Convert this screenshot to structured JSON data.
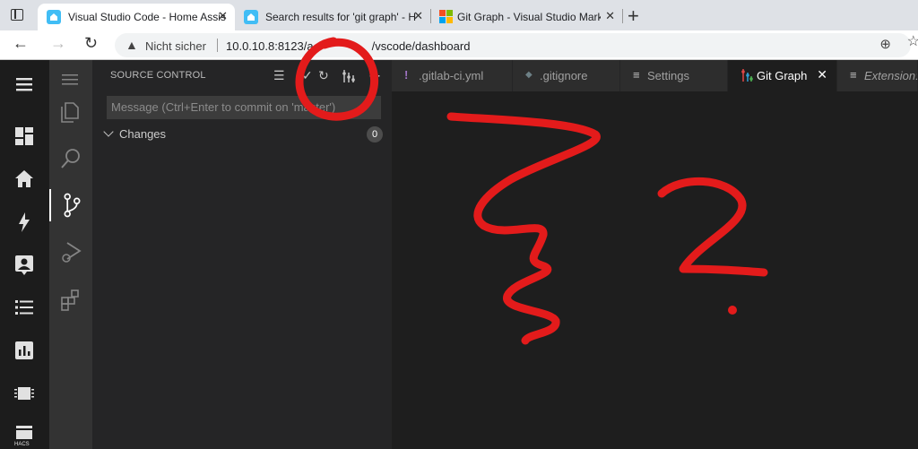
{
  "browser": {
    "tabs": [
      {
        "title": "Visual Studio Code - Home Assis",
        "icon": "home-assistant-icon",
        "active": true
      },
      {
        "title": "Search results for 'git graph' - H",
        "icon": "home-assistant-icon",
        "active": false
      },
      {
        "title": "Git Graph - Visual Studio Market",
        "icon": "microsoft-icon",
        "active": false
      }
    ],
    "close_glyph": "✕",
    "new_tab_glyph": "+",
    "security_label": "Nicht sicher",
    "url": "10.0.10.8:8123/a                  /vscode/dashboard"
  },
  "ha_sidebar": {
    "hacs_label": "HACS",
    "items": [
      "menu-icon",
      "dashboard-icon",
      "home-icon",
      "energy-icon",
      "person-card-icon",
      "logbook-icon",
      "history-icon",
      "chip-icon",
      "hacs-icon"
    ]
  },
  "source_control": {
    "title": "SOURCE CONTROL",
    "commit_placeholder": "Message (Ctrl+Enter to commit on 'master')",
    "changes_label": "Changes",
    "changes_count": "0"
  },
  "editor_tabs": [
    {
      "icon_glyph": "!",
      "label": ".gitlab-ci.yml",
      "icon_color": "#a074c4",
      "active": false
    },
    {
      "icon_glyph": "◆",
      "label": ".gitignore",
      "icon_color": "#6d8086",
      "active": false
    },
    {
      "icon_glyph": "≡",
      "label": "Settings",
      "icon_color": "#c5c5c5",
      "active": false
    },
    {
      "icon_glyph": "⑂",
      "label": "Git Graph",
      "icon_color": "#2f9fd3",
      "active": true
    },
    {
      "icon_glyph": "≡",
      "label": "Extension:",
      "icon_color": "#c5c5c5",
      "active": false
    }
  ],
  "colors": {
    "annotation_red": "#e31b1b",
    "accent_blue": "#41bdf5"
  }
}
